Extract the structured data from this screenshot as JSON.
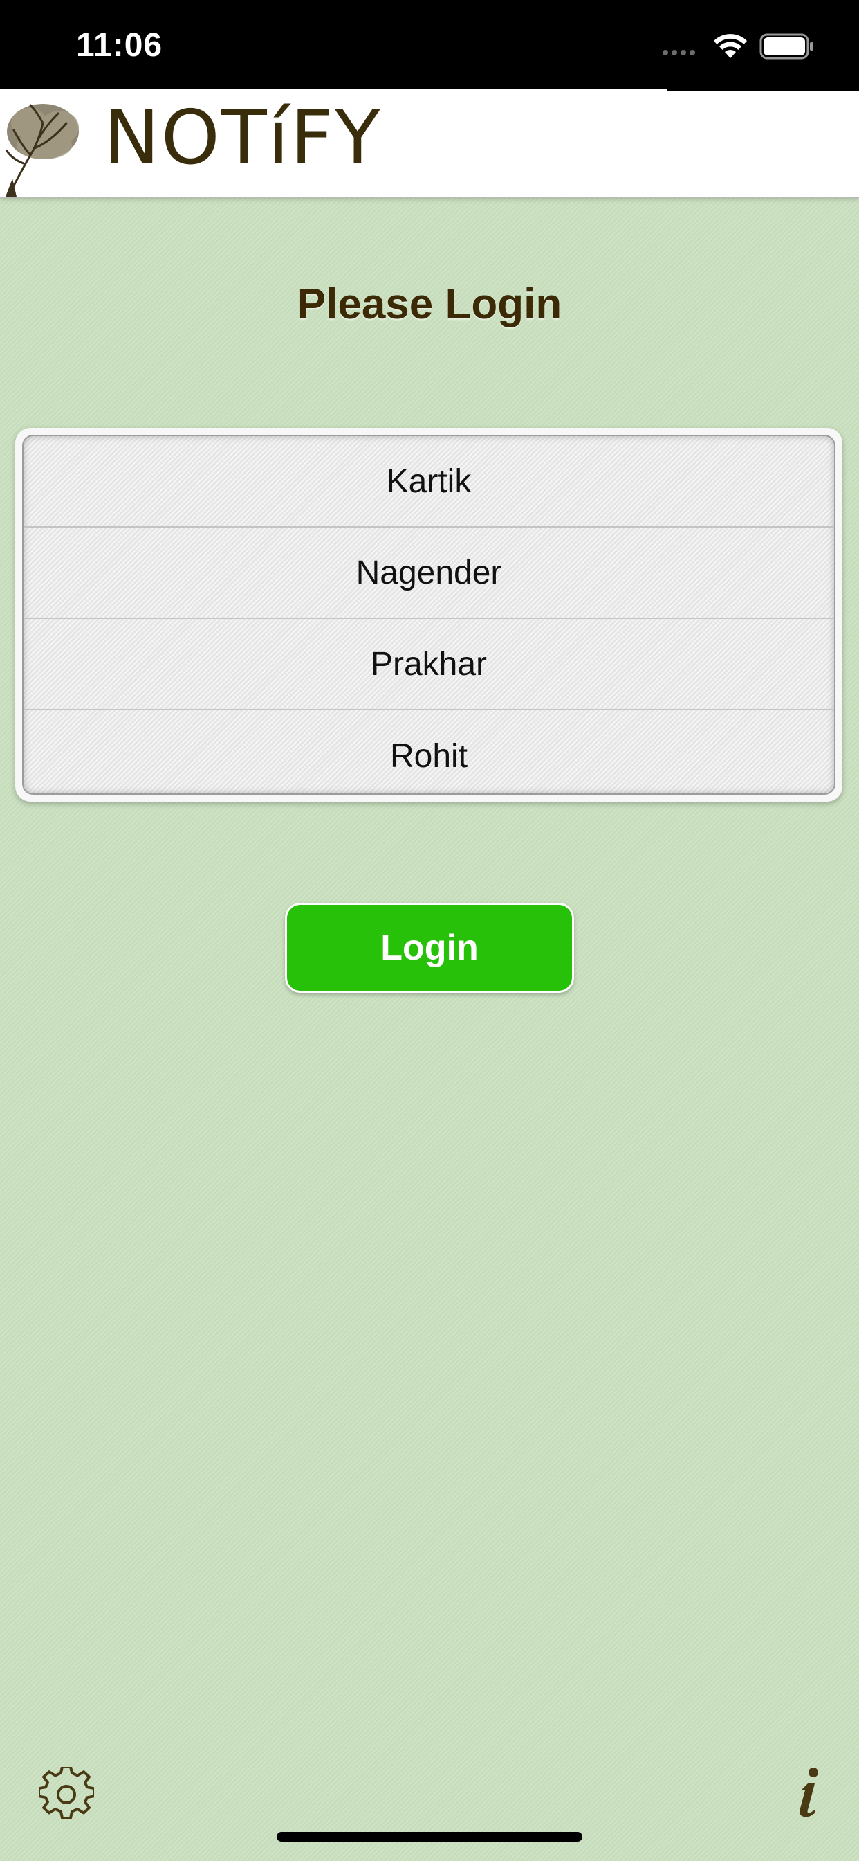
{
  "status_bar": {
    "time": "11:06"
  },
  "header": {
    "brand": "NOTíFY"
  },
  "login": {
    "title": "Please Login",
    "users": [
      "Kartik",
      "Nagender",
      "Prakhar",
      "Rohit"
    ],
    "button_label": "Login"
  },
  "colors": {
    "background": "#cae0bf",
    "login_button": "#27c10a",
    "title": "#3b2a05",
    "brand": "#3a2d0b"
  },
  "icons": {
    "settings": "gear-icon",
    "info": "info-icon"
  }
}
